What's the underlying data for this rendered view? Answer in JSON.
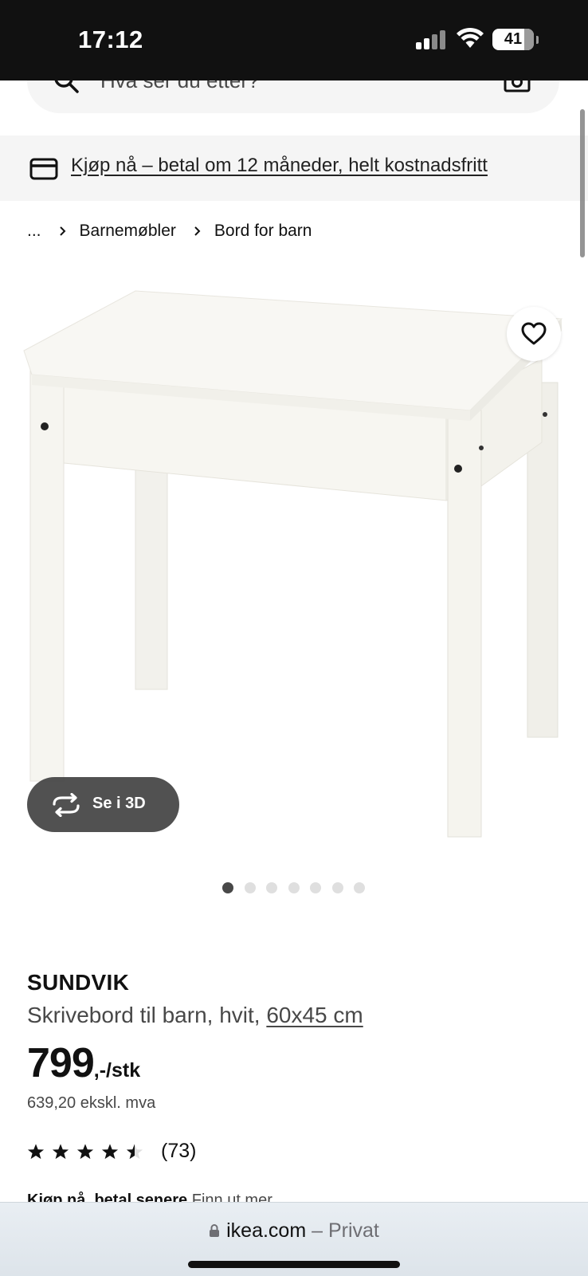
{
  "status_bar": {
    "time": "17:12",
    "battery": "41"
  },
  "search": {
    "placeholder": "Hva ser du etter?"
  },
  "promo": {
    "link_text": "Kjøp nå – betal om 12 måneder, helt kostnadsfritt"
  },
  "breadcrumb": {
    "ellipsis": "...",
    "items": [
      "Barnemøbler",
      "Bord for barn"
    ]
  },
  "gallery": {
    "view_3d_label": "Se i 3D",
    "image_count": 7,
    "active_index": 0
  },
  "product": {
    "brand": "SUNDVIK",
    "description": "Skrivebord til barn, hvit, ",
    "dimensions": "60x45 cm",
    "price": "799",
    "price_suffix": ",-/stk",
    "price_ex_vat": "639,20 ekskl. mva",
    "rating": 4.5,
    "review_count": "(73)",
    "buy_now_bold": "Kjøp nå, betal senere",
    "buy_now_link": "Finn ut mer"
  },
  "browser": {
    "domain": "ikea.com",
    "mode": " – Privat"
  },
  "icons": [
    "search-icon",
    "camera-icon",
    "credit-card-icon",
    "chevron-right-icon",
    "heart-icon",
    "rotate-3d-icon",
    "star-icon",
    "lock-icon",
    "signal-icon",
    "wifi-icon",
    "battery-icon"
  ]
}
